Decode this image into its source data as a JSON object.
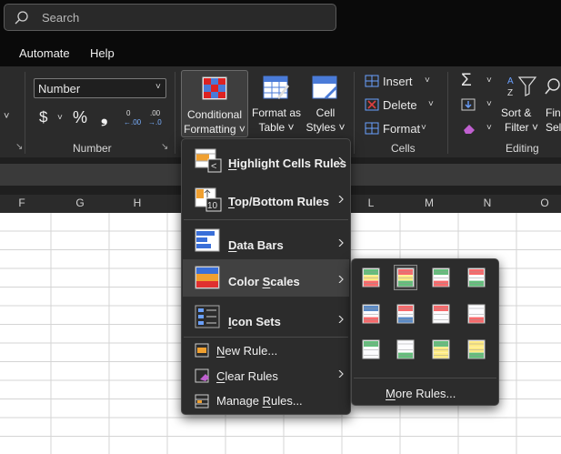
{
  "search": {
    "placeholder": "Search"
  },
  "menubar": {
    "items": [
      "Automate",
      "Help"
    ]
  },
  "ribbon": {
    "number_format": "Number",
    "currency": "$",
    "percent": "%",
    "comma": "9",
    "groups": {
      "number": "Number",
      "cells": "Cells",
      "editing": "Editing"
    },
    "conditional_formatting": [
      "Conditional",
      "Formatting ˅"
    ],
    "format_as_table": [
      "Format as",
      "Table ˅"
    ],
    "cell_styles": [
      "Cell",
      "Styles ˅"
    ],
    "insert": "Insert",
    "delete": "Delete",
    "format": "Format",
    "sort_filter": [
      "Sort &",
      "Filter ˅"
    ],
    "find_select": [
      "Fin",
      "Sele"
    ]
  },
  "columns": [
    "F",
    "G",
    "H",
    "L",
    "M",
    "N",
    "O"
  ],
  "cf_menu": {
    "highlight": {
      "u": "H",
      "rest": "ighlight Cells Rules"
    },
    "topbottom": {
      "u": "T",
      "rest": "op/Bottom Rules"
    },
    "databars": {
      "u": "D",
      "rest": "ata Bars"
    },
    "colorscales": {
      "pre": "Color ",
      "u": "S",
      "rest": "cales"
    },
    "iconsets": {
      "u": "I",
      "rest": "con Sets"
    },
    "newrule": {
      "u": "N",
      "rest": "ew Rule..."
    },
    "clearrules": {
      "u": "C",
      "rest": "lear Rules"
    },
    "managerules": {
      "pre": "Manage ",
      "u": "R",
      "rest": "ules..."
    }
  },
  "colorscales_sub": {
    "more": {
      "u": "M",
      "rest": "ore Rules..."
    },
    "swatches": [
      [
        "#63be7b",
        "#ffeb84",
        "#f8696b"
      ],
      [
        "#f8696b",
        "#ffeb84",
        "#63be7b"
      ],
      [
        "#63be7b",
        "#fcfcff",
        "#f8696b"
      ],
      [
        "#f8696b",
        "#fcfcff",
        "#63be7b"
      ],
      [
        "#5a8ac6",
        "#fcfcff",
        "#f8696b"
      ],
      [
        "#f8696b",
        "#fcfcff",
        "#5a8ac6"
      ],
      [
        "#f8696b",
        "#fcfcff",
        "#fcfcff"
      ],
      [
        "#fcfcff",
        "#fcfcff",
        "#f8696b"
      ],
      [
        "#63be7b",
        "#fcfcff",
        "#fcfcff"
      ],
      [
        "#fcfcff",
        "#fcfcff",
        "#63be7b"
      ],
      [
        "#63be7b",
        "#ffeb84",
        "#ffeb84"
      ],
      [
        "#ffeb84",
        "#ffeb84",
        "#63be7b"
      ]
    ]
  }
}
